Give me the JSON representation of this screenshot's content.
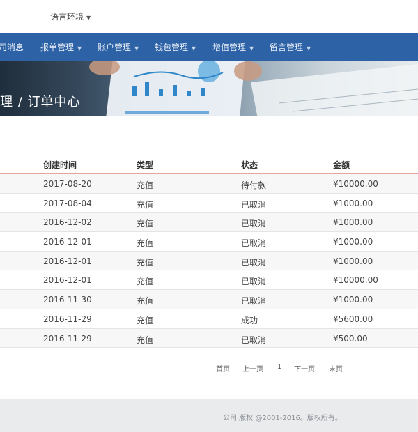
{
  "header": {
    "language_label": "语言环境"
  },
  "nav": {
    "items": [
      {
        "label": "司消息"
      },
      {
        "label": "报单管理"
      },
      {
        "label": "账户管理"
      },
      {
        "label": "钱包管理"
      },
      {
        "label": "增值管理"
      },
      {
        "label": "留言管理"
      }
    ]
  },
  "banner": {
    "breadcrumb": "理 / 订单中心"
  },
  "table": {
    "headers": {
      "time": "创建时间",
      "type": "类型",
      "status": "状态",
      "amount": "金额"
    },
    "rows": [
      {
        "time": "2017-08-20",
        "type": "充值",
        "status": "待付款",
        "amount": "¥10000.00"
      },
      {
        "time": "2017-08-04",
        "type": "充值",
        "status": "已取消",
        "amount": "¥1000.00"
      },
      {
        "time": "2016-12-02",
        "type": "充值",
        "status": "已取消",
        "amount": "¥1000.00"
      },
      {
        "time": "2016-12-01",
        "type": "充值",
        "status": "已取消",
        "amount": "¥1000.00"
      },
      {
        "time": "2016-12-01",
        "type": "充值",
        "status": "已取消",
        "amount": "¥1000.00"
      },
      {
        "time": "2016-12-01",
        "type": "充值",
        "status": "已取消",
        "amount": "¥10000.00"
      },
      {
        "time": "2016-11-30",
        "type": "充值",
        "status": "已取消",
        "amount": "¥1000.00"
      },
      {
        "time": "2016-11-29",
        "type": "充值",
        "status": "成功",
        "amount": "¥5600.00"
      },
      {
        "time": "2016-11-29",
        "type": "充值",
        "status": "已取消",
        "amount": "¥500.00"
      }
    ]
  },
  "pagination": {
    "first": "首页",
    "prev": "上一页",
    "current": "1",
    "next": "下一页",
    "last": "末页"
  },
  "footer": {
    "copyright": "公司 版权 @2001-2016。版权所有。"
  },
  "colors": {
    "nav_bg": "#2e62a6",
    "header_underline": "#e8a796",
    "footer_bg": "#e9ebed"
  }
}
